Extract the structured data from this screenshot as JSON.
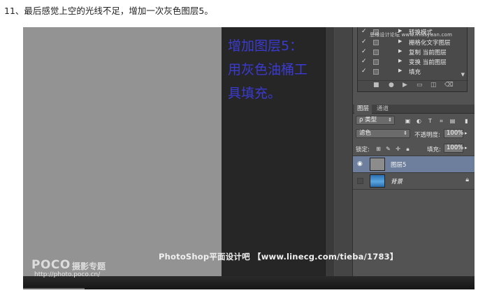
{
  "caption": "11、最后感觉上空的光线不足，增加一次灰色图层5。",
  "instruction": {
    "lines": [
      "增加图层5：",
      "用灰色油桶工",
      "具填充。"
    ]
  },
  "actions_panel": {
    "watermark": "思缘设计论坛 www.missyuan.com",
    "items": [
      {
        "check": "✓",
        "label": "转换模式"
      },
      {
        "check": "✓",
        "label": "栅格化文字图层"
      },
      {
        "check": "✓",
        "label": "复制 当前图层"
      },
      {
        "check": "✓",
        "label": "变换 当前图层"
      },
      {
        "check": "✓",
        "label": "填充"
      }
    ]
  },
  "layers_panel": {
    "tabs": [
      {
        "label": "图层",
        "active": true
      },
      {
        "label": "通道",
        "active": false
      }
    ],
    "filter_label": "ρ 类型",
    "blend_mode": "滤色",
    "opacity_label": "不透明度:",
    "opacity_value": "100%",
    "lock_label": "锁定:",
    "fill_label": "填充:",
    "fill_value": "100%",
    "layers": [
      {
        "name": "图层5",
        "selected": true,
        "visible": true,
        "thumb_color": "#8c8c8c"
      },
      {
        "name": "背景",
        "selected": false,
        "visible": false,
        "thumb_color": "#3d88c9",
        "locked": true
      }
    ]
  },
  "watermarks": {
    "poco_logo": "POCO",
    "poco_subtitle": "摄影专题",
    "poco_url": "http://photo.poco.cn/",
    "banner": "PhotoShop平面设计吧 【www.linecg.com/tieba/1783】"
  },
  "colors": {
    "instruction_text": "#3b3bd1",
    "canvas_gray": "#939393",
    "selected_layer": "#6d7f9c"
  }
}
